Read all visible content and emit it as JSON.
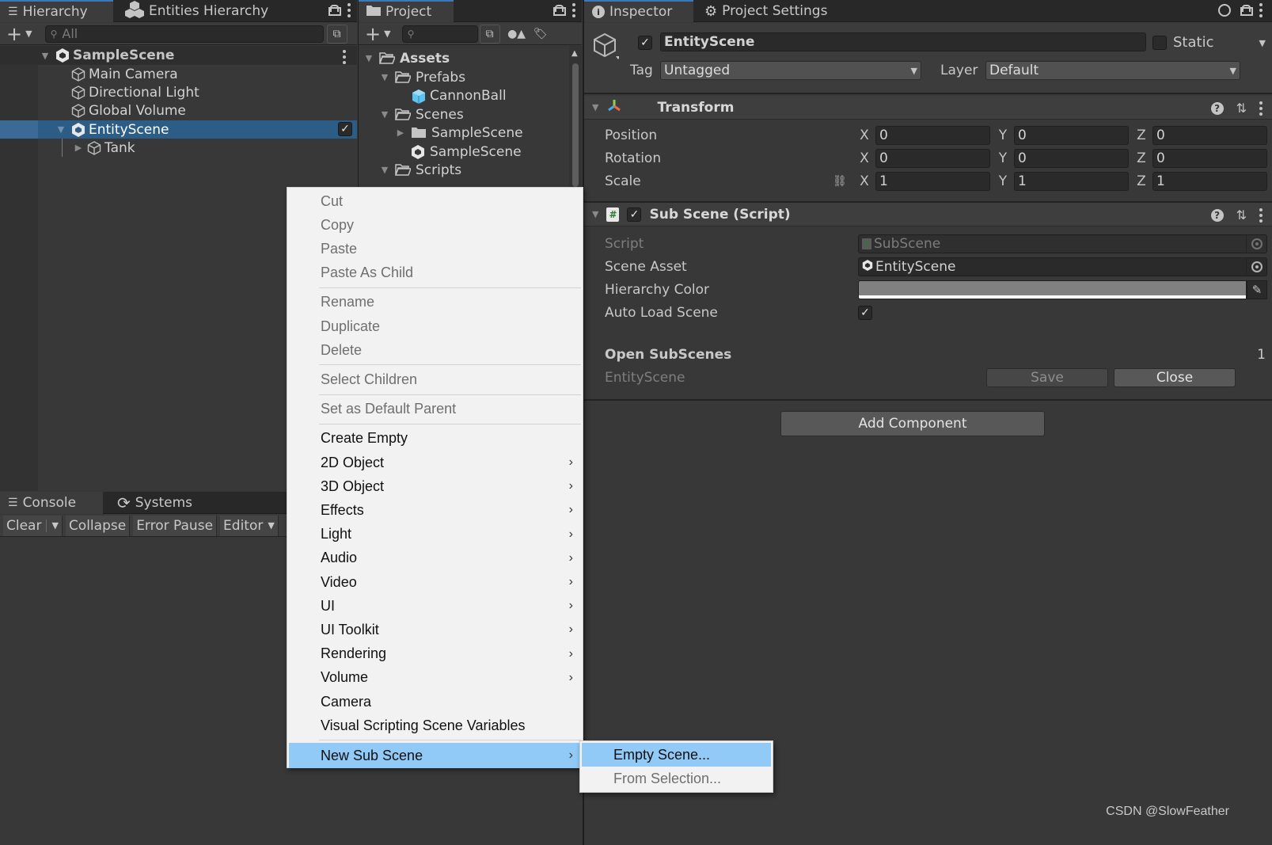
{
  "hierarchy": {
    "tabs": [
      {
        "label": "Hierarchy",
        "icon": "list-icon",
        "active": true
      },
      {
        "label": "Entities Hierarchy",
        "icon": "entities-icon",
        "active": false
      }
    ],
    "search_placeholder": "All",
    "scene": "SampleScene",
    "items": [
      {
        "label": "Main Camera",
        "depth": 1
      },
      {
        "label": "Directional Light",
        "depth": 1
      },
      {
        "label": "Global Volume",
        "depth": 1
      },
      {
        "label": "EntityScene",
        "depth": 1,
        "selected": true,
        "expanded": true,
        "subscene": true,
        "enabled": true
      },
      {
        "label": "Tank",
        "depth": 2,
        "collapsed": true
      }
    ]
  },
  "project": {
    "tab": "Project",
    "search_placeholder": "",
    "tree": [
      {
        "label": "Assets",
        "type": "folder-open",
        "bold": true
      },
      {
        "label": "Prefabs",
        "type": "folder-open"
      },
      {
        "label": "CannonBall",
        "type": "prefab"
      },
      {
        "label": "Scenes",
        "type": "folder-open"
      },
      {
        "label": "SampleScene",
        "type": "folder"
      },
      {
        "label": "SampleScene",
        "type": "scene"
      },
      {
        "label": "Scripts",
        "type": "folder-open"
      }
    ]
  },
  "inspector": {
    "tabs": [
      {
        "label": "Inspector",
        "icon": "info-icon",
        "active": true
      },
      {
        "label": "Project Settings",
        "icon": "gear-icon",
        "active": false
      }
    ],
    "object_name": "EntityScene",
    "active": true,
    "static_label": "Static",
    "static": false,
    "tag_label": "Tag",
    "tag_value": "Untagged",
    "layer_label": "Layer",
    "layer_value": "Default",
    "transform": {
      "title": "Transform",
      "rows": [
        {
          "label": "Position",
          "x": "0",
          "y": "0",
          "z": "0"
        },
        {
          "label": "Rotation",
          "x": "0",
          "y": "0",
          "z": "0"
        },
        {
          "label": "Scale",
          "x": "1",
          "y": "1",
          "z": "1"
        }
      ],
      "axis": [
        "X",
        "Y",
        "Z"
      ]
    },
    "subscene": {
      "title": "Sub Scene (Script)",
      "enabled": true,
      "script_label": "Script",
      "script_value": "SubScene",
      "scene_asset_label": "Scene Asset",
      "scene_asset_value": "EntityScene",
      "hierarchy_color_label": "Hierarchy Color",
      "hierarchy_color": "#808080",
      "auto_load_label": "Auto Load Scene",
      "auto_load": true,
      "open_subscenes_label": "Open SubScenes",
      "open_subscenes_count": "1",
      "open_scene_name": "EntityScene",
      "save_label": "Save",
      "close_label": "Close"
    },
    "add_component_label": "Add Component"
  },
  "console": {
    "tabs": [
      {
        "label": "Console",
        "icon": "console-icon",
        "active": true
      },
      {
        "label": "Systems",
        "icon": "systems-icon",
        "active": false
      }
    ],
    "buttons": {
      "clear": "Clear",
      "collapse": "Collapse",
      "error_pause": "Error Pause",
      "editor": "Editor"
    }
  },
  "context_menu": {
    "items": [
      {
        "label": "Cut",
        "disabled": true
      },
      {
        "label": "Copy",
        "disabled": true
      },
      {
        "label": "Paste",
        "disabled": true
      },
      {
        "label": "Paste As Child",
        "disabled": true
      },
      {
        "sep": true
      },
      {
        "label": "Rename",
        "disabled": true
      },
      {
        "label": "Duplicate",
        "disabled": true
      },
      {
        "label": "Delete",
        "disabled": true
      },
      {
        "sep": true
      },
      {
        "label": "Select Children",
        "disabled": true
      },
      {
        "sep": true
      },
      {
        "label": "Set as Default Parent",
        "disabled": true
      },
      {
        "sep": true
      },
      {
        "label": "Create Empty"
      },
      {
        "label": "2D Object",
        "submenu": true
      },
      {
        "label": "3D Object",
        "submenu": true
      },
      {
        "label": "Effects",
        "submenu": true
      },
      {
        "label": "Light",
        "submenu": true
      },
      {
        "label": "Audio",
        "submenu": true
      },
      {
        "label": "Video",
        "submenu": true
      },
      {
        "label": "UI",
        "submenu": true
      },
      {
        "label": "UI Toolkit",
        "submenu": true
      },
      {
        "label": "Rendering",
        "submenu": true
      },
      {
        "label": "Volume",
        "submenu": true
      },
      {
        "label": "Camera"
      },
      {
        "label": "Visual Scripting Scene Variables"
      },
      {
        "sep": true
      },
      {
        "label": "New Sub Scene",
        "submenu": true,
        "highlight": true
      }
    ],
    "submenu": [
      {
        "label": "Empty Scene...",
        "highlight": true
      },
      {
        "label": "From Selection...",
        "disabled": true
      }
    ]
  },
  "watermark": "CSDN @SlowFeather",
  "colors": {
    "selection": "#2c5d87",
    "menu_highlight": "#91c9f7",
    "tab_active_accent": "#3a79bb",
    "prefab_blue": "#5ec3f0"
  }
}
